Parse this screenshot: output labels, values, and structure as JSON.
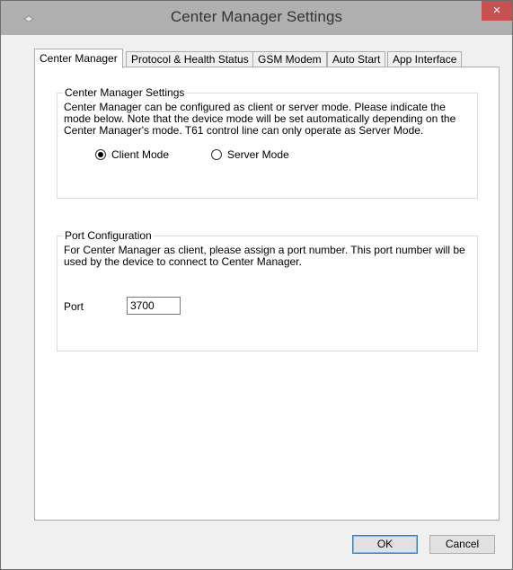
{
  "window": {
    "title": "Center Manager Settings",
    "close_glyph": "×"
  },
  "tabs": [
    {
      "label": "Center Manager",
      "active": true
    },
    {
      "label": "Protocol & Health Status",
      "active": false
    },
    {
      "label": "GSM Modem",
      "active": false
    },
    {
      "label": "Auto Start",
      "active": false
    },
    {
      "label": "App Interface",
      "active": false
    }
  ],
  "settings_group": {
    "title": "Center Manager Settings",
    "description": "Center Manager can be configured as client or server mode. Please indicate the\nmode below. Note that the device mode will be set automatically depending on the\nCenter Manager's mode. T61 control line can only operate as Server Mode.",
    "client_mode_label": "Client Mode",
    "server_mode_label": "Server Mode",
    "selected_mode": "Client Mode"
  },
  "port_group": {
    "title": "Port Configuration",
    "description": "For Center Manager as client, please assign a port number. This port number will be\nused by the device to connect to Center Manager.",
    "port_label": "Port",
    "port_value": "3700"
  },
  "buttons": {
    "ok": "OK",
    "cancel": "Cancel"
  },
  "colors": {
    "titlebar": "#b0b0b0",
    "close_button": "#c75050",
    "default_button_border": "#3c7fb1"
  }
}
